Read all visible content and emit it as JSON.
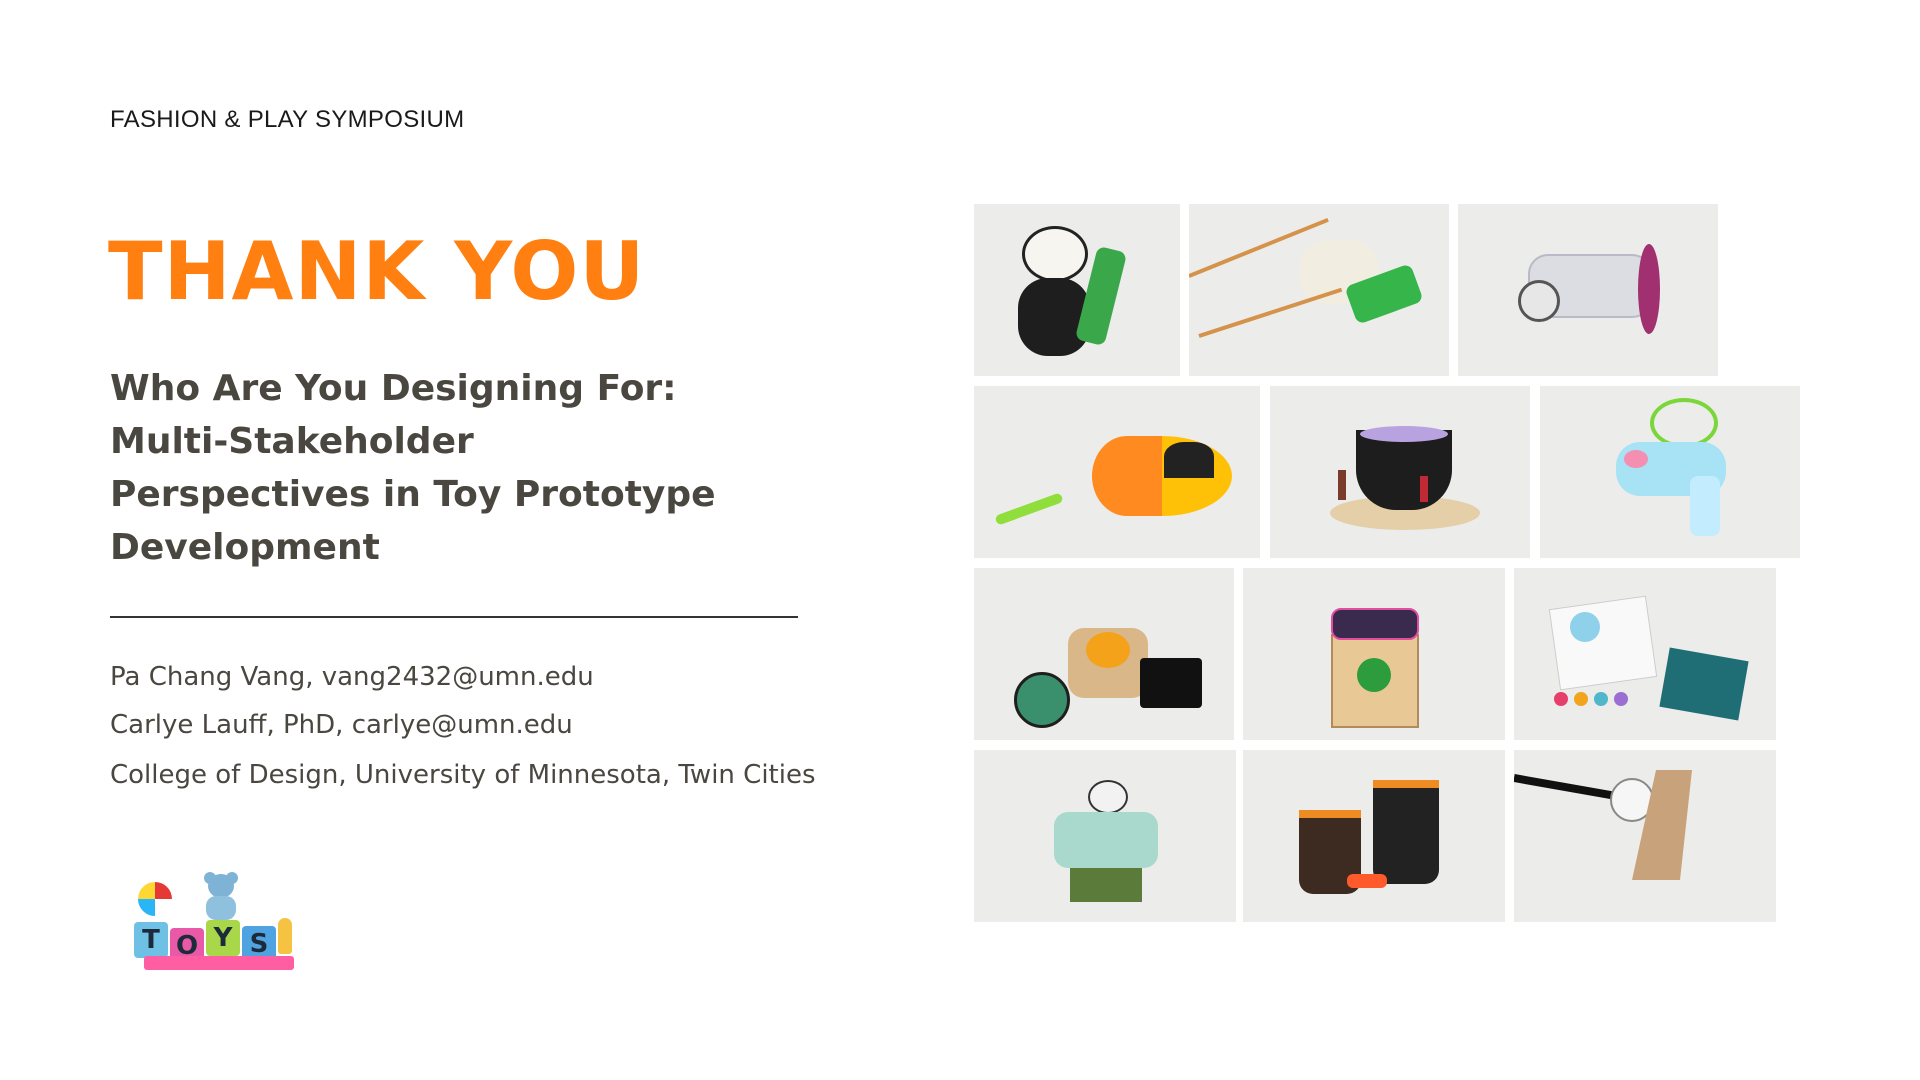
{
  "header": {
    "symposium": "FASHION & PLAY SYMPOSIUM"
  },
  "title": "THANK YOU",
  "subtitle_lines": [
    "Who Are You Designing For:",
    "Multi-Stakeholder",
    "Perspectives in Toy Prototype",
    "Development"
  ],
  "authors": [
    "Pa Chang Vang, vang2432@umn.edu",
    "Carlye Lauff, PhD, carlye@umn.edu",
    "College of Design, University of Minnesota, Twin Cities"
  ],
  "logo": {
    "letters": [
      "T",
      "O",
      "Y",
      "S"
    ]
  },
  "colors": {
    "accent": "#ff7f11",
    "text": "#4a4740"
  },
  "photos": [
    "panda-toy-photo",
    "knit-launcher-photo",
    "wheeled-cart-photo",
    "fishing-game-photo",
    "cauldron-dropper-photo",
    "bubble-gun-photo",
    "wheel-spinner-photo",
    "drum-box-photo",
    "paint-kit-photo",
    "sprinkler-toy-photo",
    "bucket-set-photo",
    "pole-contraption-photo"
  ]
}
